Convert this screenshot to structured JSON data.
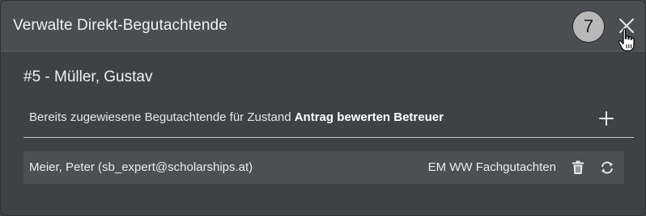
{
  "modal": {
    "title": "Verwalte Direkt-Begutachtende",
    "step_number": "7",
    "close_icon": "close-icon"
  },
  "subject": {
    "heading": "#5 - Müller, Gustav"
  },
  "section": {
    "label_prefix": "Bereits zugewiesene Begutachtende für Zustand ",
    "label_state": "Antrag bewerten Betreuer",
    "add_icon": "plus-icon"
  },
  "reviewers": [
    {
      "name": "Meier, Peter (sb_expert@scholarships.at)",
      "role": "EM WW Fachgutachten",
      "delete_icon": "trash-icon",
      "swap_icon": "refresh-icon"
    }
  ],
  "colors": {
    "background": "#3e4145",
    "header": "#4a4d51",
    "row": "#4c4f53",
    "text": "#f1f1f1"
  }
}
